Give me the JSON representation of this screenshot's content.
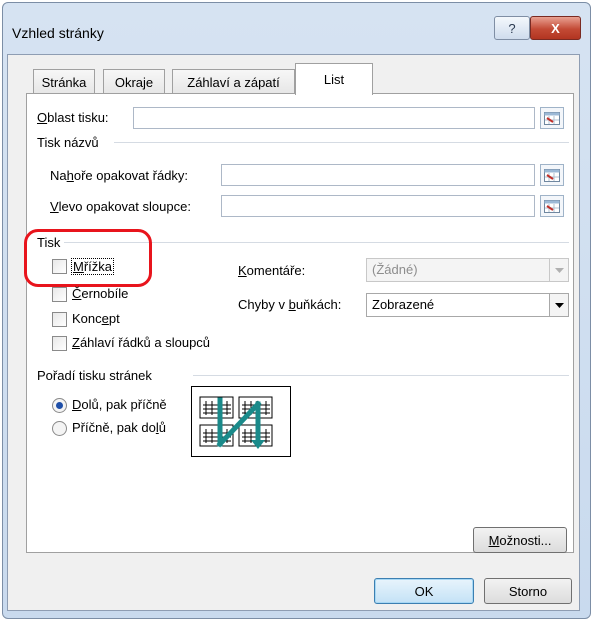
{
  "window": {
    "title": "Vzhled stránky",
    "help_glyph": "?",
    "close_glyph": "X"
  },
  "tabs": [
    {
      "label": "Stránka",
      "active": false
    },
    {
      "label": "Okraje",
      "active": false
    },
    {
      "label": "Záhlaví a zápatí",
      "active": false
    },
    {
      "label": "List",
      "active": true
    }
  ],
  "print_area": {
    "label_key": "O",
    "label_rest": "blast tisku:",
    "value": ""
  },
  "print_titles": {
    "section": "Tisk názvů",
    "rows": {
      "label_pre": "Na",
      "label_key": "h",
      "label_post": "oře opakovat řádky:",
      "value": ""
    },
    "cols": {
      "label_key": "V",
      "label_rest": "levo opakovat sloupce:",
      "value": ""
    }
  },
  "print": {
    "section": "Tisk",
    "gridlines": {
      "label_key": "M",
      "label_rest": "řížka",
      "checked": false
    },
    "black_white": {
      "label_key": "Č",
      "label_rest": "ernobíle",
      "checked": false
    },
    "draft": {
      "label_pre": "Konc",
      "label_key": "e",
      "label_post": "pt",
      "checked": false
    },
    "headings": {
      "label_key": "Z",
      "label_rest": "áhlaví řádků a sloupců",
      "checked": false
    },
    "comments": {
      "label_key": "K",
      "label_rest": "omentáře:",
      "value": "(Žádné)",
      "enabled": false
    },
    "errors": {
      "label_pre": "Chyby v ",
      "label_key": "b",
      "label_post": "uňkách:",
      "value": "Zobrazené"
    }
  },
  "page_order": {
    "section": "Pořadí tisku stránek",
    "down_then_over": {
      "label_key": "D",
      "label_rest": "olů, pak příčně",
      "selected": true
    },
    "over_then_down": {
      "label_pre": "Příčně, pak do",
      "label_key": "l",
      "label_post": "ů",
      "selected": false
    }
  },
  "buttons": {
    "options": {
      "label_key": "M",
      "label_rest": "ožnosti..."
    },
    "ok": "OK",
    "cancel": "Storno"
  },
  "colors": {
    "highlight": "#e8141c",
    "arrow": "#1a8a8a"
  }
}
